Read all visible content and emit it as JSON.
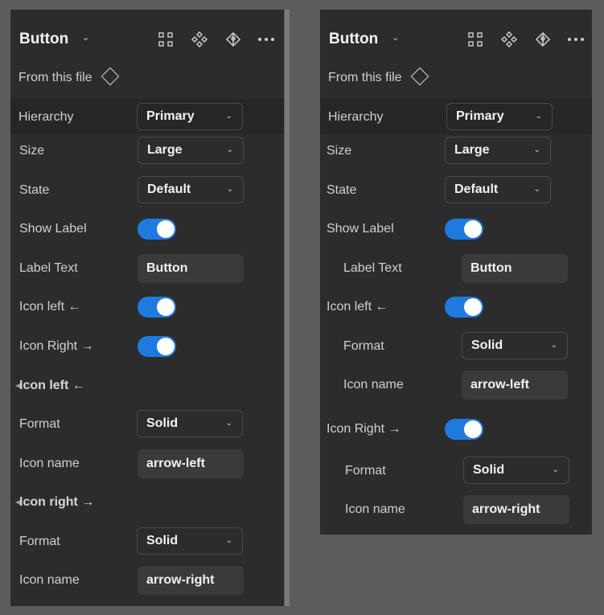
{
  "panel_a": {
    "title": "Button",
    "source": "From this file",
    "props": {
      "hierarchy": {
        "label": "Hierarchy",
        "value": "Primary"
      },
      "size": {
        "label": "Size",
        "value": "Large"
      },
      "state": {
        "label": "State",
        "value": "Default"
      },
      "show_label": {
        "label": "Show Label"
      },
      "label_text": {
        "label": "Label Text",
        "value": "Button"
      },
      "icon_left": {
        "label": "Icon left ←"
      },
      "icon_right": {
        "label": "Icon Right →"
      }
    },
    "section_left": {
      "title": "Icon left ←",
      "format_label": "Format",
      "format_value": "Solid",
      "name_label": "Icon name",
      "name_value": "arrow-left"
    },
    "section_right": {
      "title": "Icon right →",
      "format_label": "Format",
      "format_value": "Solid",
      "name_label": "Icon name",
      "name_value": "arrow-right"
    }
  },
  "panel_b": {
    "title": "Button",
    "source": "From this file",
    "props": {
      "hierarchy": {
        "label": "Hierarchy",
        "value": "Primary"
      },
      "size": {
        "label": "Size",
        "value": "Large"
      },
      "state": {
        "label": "State",
        "value": "Default"
      },
      "show_label": {
        "label": "Show Label"
      },
      "label_text": {
        "label": "Label Text",
        "value": "Button"
      },
      "icon_left": {
        "label": "Icon left ←",
        "format_label": "Format",
        "format_value": "Solid",
        "name_label": "Icon name",
        "name_value": "arrow-left"
      },
      "icon_right": {
        "label": "Icon Right →",
        "format_label": "Format",
        "format_value": "Solid",
        "name_label": "Icon name",
        "name_value": "arrow-right"
      }
    }
  },
  "toggles": {
    "show_label": true,
    "icon_left": true,
    "icon_right": true
  },
  "icons": [
    "chevron-down-icon",
    "grid-icon",
    "component-icon",
    "pen-tool-icon",
    "more-icon",
    "diamond-icon"
  ],
  "colors": {
    "panel": "#2c2c2c",
    "toggle_on": "#1f7ae0",
    "background": "#5c5c5c"
  }
}
